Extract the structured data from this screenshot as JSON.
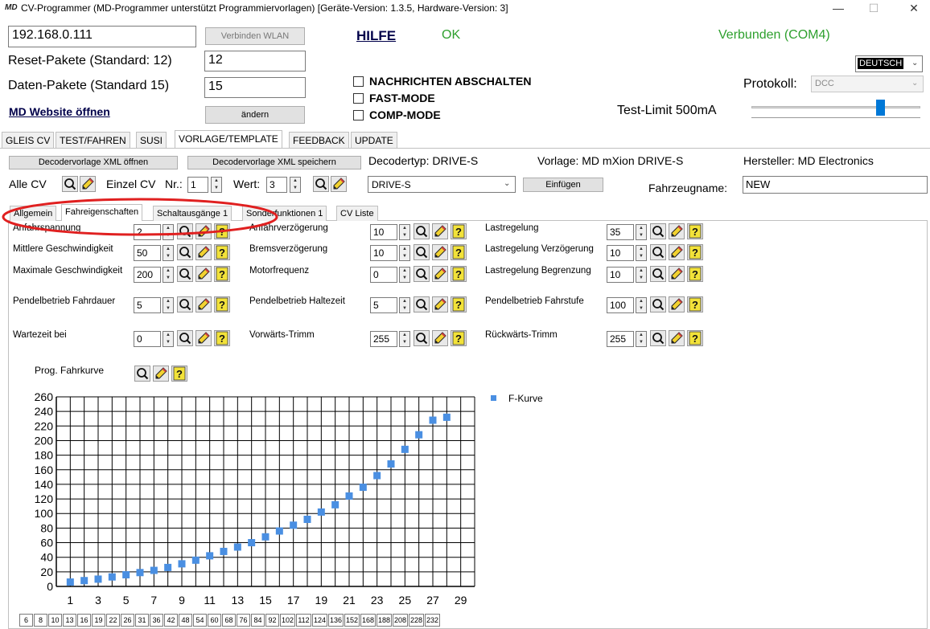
{
  "window": {
    "title": "CV-Programmer (MD-Programmer unterstützt Programmiervorlagen)  [Geräte-Version: 1.3.5, Hardware-Version: 3]",
    "icon_text": "MD",
    "minimize": "—",
    "maximize": "☐",
    "close": "✕"
  },
  "connection": {
    "ip": "192.168.0.111",
    "connect_wlan": "Verbinden WLAN",
    "help": "HILFE",
    "ok": "OK",
    "status": "Verbunden (COM4)",
    "status_color": "#2ea02e"
  },
  "settings": {
    "reset_label": "Reset-Pakete (Standard: 12)",
    "reset_value": "12",
    "data_label": "Daten-Pakete (Standard 15)",
    "data_value": "15",
    "website_link": "MD Website öffnen",
    "change_button": "ändern",
    "mute_messages": "NACHRICHTEN ABSCHALTEN",
    "fast_mode": "FAST-MODE",
    "comp_mode": "COMP-MODE",
    "language": "DEUTSCH",
    "protocol_label": "Protokoll:",
    "protocol_value": "DCC",
    "test_limit": "Test-Limit 500mA",
    "test_limit_level": 0.78
  },
  "main_tabs": [
    "GLEIS CV",
    "TEST/FAHREN",
    "SUSI",
    "VORLAGE/TEMPLATE",
    "FEEDBACK",
    "UPDATE"
  ],
  "template": {
    "open_xml": "Decodervorlage XML öffnen",
    "save_xml": "Decodervorlage XML speichern",
    "decoder_type": "Decodertyp: DRIVE-S",
    "template_name": "Vorlage: MD mXion DRIVE-S",
    "manufacturer": "Hersteller: MD Electronics",
    "all_cv": "Alle CV",
    "single_cv": "Einzel CV",
    "nr_label": "Nr.:",
    "nr_value": "1",
    "value_label": "Wert:",
    "value_value": "3",
    "decoder_select": "DRIVE-S",
    "insert_button": "Einfügen",
    "vehicle_name_label": "Fahrzeugname:",
    "vehicle_name_value": "NEW"
  },
  "sub_tabs": [
    "Allgemein",
    "Fahreigenschaften",
    "Schaltausgänge 1",
    "Sonderfunktionen 1",
    "CV Liste"
  ],
  "params": {
    "col1": [
      {
        "label": "Anfahrspannung",
        "value": "2"
      },
      {
        "label": "Mittlere Geschwindigkeit",
        "value": "50"
      },
      {
        "label": "Maximale Geschwindigkeit",
        "value": "200"
      },
      {
        "label": "Pendelbetrieb Fahrdauer",
        "value": "5"
      },
      {
        "label": "Wartezeit bei",
        "value": "0"
      }
    ],
    "col2": [
      {
        "label": "Anfahrverzögerung",
        "value": "10"
      },
      {
        "label": "Bremsverzögerung",
        "value": "10"
      },
      {
        "label": "Motorfrequenz",
        "value": "0"
      },
      {
        "label": "Pendelbetrieb Haltezeit",
        "value": "5"
      },
      {
        "label": "Vorwärts-Trimm",
        "value": "255"
      }
    ],
    "col3": [
      {
        "label": "Lastregelung",
        "value": "35"
      },
      {
        "label": "Lastregelung Verzögerung",
        "value": "10"
      },
      {
        "label": "Lastregelung Begrenzung",
        "value": "10"
      },
      {
        "label": "Pendelbetrieb Fahrstufe",
        "value": "100"
      },
      {
        "label": "Rückwärts-Trimm",
        "value": "255"
      }
    ]
  },
  "curve": {
    "label": "Prog. Fahrkurve",
    "values": [
      "6",
      "8",
      "10",
      "13",
      "16",
      "19",
      "22",
      "26",
      "31",
      "36",
      "42",
      "48",
      "54",
      "60",
      "68",
      "76",
      "84",
      "92",
      "102",
      "112",
      "124",
      "136",
      "152",
      "168",
      "188",
      "208",
      "228",
      "232"
    ]
  },
  "chart_data": {
    "type": "scatter",
    "title": "",
    "xlabel": "",
    "ylabel": "",
    "xlim": [
      0,
      30
    ],
    "ylim": [
      0,
      260
    ],
    "x_ticks": [
      "1",
      "3",
      "5",
      "7",
      "9",
      "11",
      "13",
      "15",
      "17",
      "19",
      "21",
      "23",
      "25",
      "27",
      "29"
    ],
    "y_ticks": [
      "0",
      "20",
      "40",
      "60",
      "80",
      "100",
      "120",
      "140",
      "160",
      "180",
      "200",
      "220",
      "240",
      "260"
    ],
    "grid": true,
    "legend": "top-right",
    "series": [
      {
        "name": "F-Kurve",
        "color": "#4a8fe2",
        "x": [
          1,
          2,
          3,
          4,
          5,
          6,
          7,
          8,
          9,
          10,
          11,
          12,
          13,
          14,
          15,
          16,
          17,
          18,
          19,
          20,
          21,
          22,
          23,
          24,
          25,
          26,
          27,
          28
        ],
        "y": [
          6,
          8,
          10,
          13,
          16,
          19,
          22,
          26,
          31,
          36,
          42,
          48,
          54,
          60,
          68,
          76,
          84,
          92,
          102,
          112,
          124,
          136,
          152,
          168,
          188,
          208,
          228,
          232
        ]
      }
    ]
  },
  "annotation": {
    "highlight_color": "#e02020"
  }
}
